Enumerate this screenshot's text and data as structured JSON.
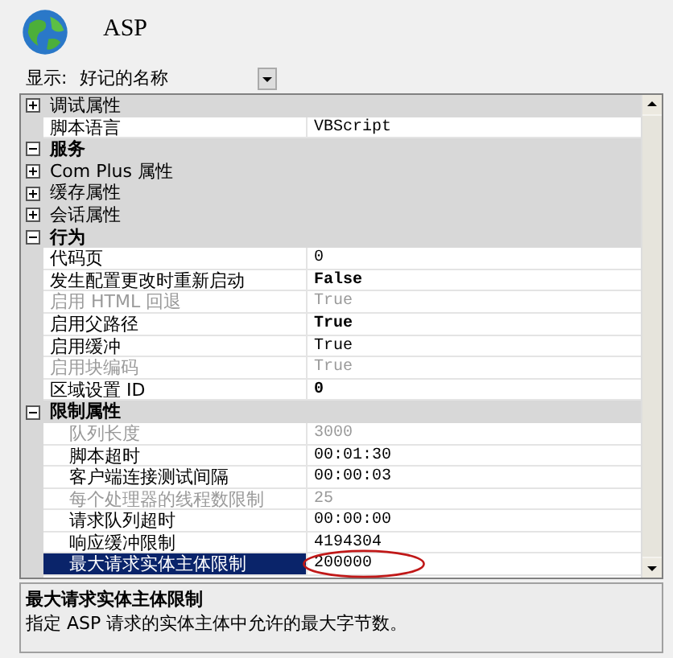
{
  "header": {
    "title": "ASP"
  },
  "display": {
    "label": "显示:",
    "value": "好记的名称"
  },
  "rows": [
    {
      "kind": "category",
      "name": "调试属性",
      "expanded": false
    },
    {
      "kind": "property",
      "name": "脚本语言",
      "value": "VBScript",
      "disabled": false,
      "modified": false,
      "selected": false,
      "circled": false
    },
    {
      "kind": "category",
      "name": "服务",
      "expanded": true,
      "children": [
        {
          "kind": "category",
          "name": "Com Plus 属性",
          "expanded": false
        },
        {
          "kind": "category",
          "name": "缓存属性",
          "expanded": false
        },
        {
          "kind": "category",
          "name": "会话属性",
          "expanded": false
        }
      ]
    },
    {
      "kind": "category",
      "name": "行为",
      "expanded": true,
      "children": [
        {
          "kind": "property",
          "name": "代码页",
          "value": "0",
          "disabled": false,
          "modified": false,
          "selected": false,
          "circled": false
        },
        {
          "kind": "property",
          "name": "发生配置更改时重新启动",
          "value": "False",
          "disabled": false,
          "modified": true,
          "selected": false,
          "circled": false
        },
        {
          "kind": "property",
          "name": "启用 HTML 回退",
          "value": "True",
          "disabled": true,
          "modified": false,
          "selected": false,
          "circled": false
        },
        {
          "kind": "property",
          "name": "启用父路径",
          "value": "True",
          "disabled": false,
          "modified": true,
          "selected": false,
          "circled": false
        },
        {
          "kind": "property",
          "name": "启用缓冲",
          "value": "True",
          "disabled": false,
          "modified": false,
          "selected": false,
          "circled": false
        },
        {
          "kind": "property",
          "name": "启用块编码",
          "value": "True",
          "disabled": true,
          "modified": false,
          "selected": false,
          "circled": false
        },
        {
          "kind": "property",
          "name": "区域设置 ID",
          "value": "0",
          "disabled": false,
          "modified": true,
          "selected": false,
          "circled": false
        },
        {
          "kind": "category",
          "name": "限制属性",
          "expanded": true,
          "children": [
            {
              "kind": "property",
              "name": "队列长度",
              "value": "3000",
              "disabled": true,
              "modified": false,
              "selected": false,
              "circled": false
            },
            {
              "kind": "property",
              "name": "脚本超时",
              "value": "00:01:30",
              "disabled": false,
              "modified": false,
              "selected": false,
              "circled": false
            },
            {
              "kind": "property",
              "name": "客户端连接测试间隔",
              "value": "00:00:03",
              "disabled": false,
              "modified": false,
              "selected": false,
              "circled": false
            },
            {
              "kind": "property",
              "name": "每个处理器的线程数限制",
              "value": "25",
              "disabled": true,
              "modified": false,
              "selected": false,
              "circled": false
            },
            {
              "kind": "property",
              "name": "请求队列超时",
              "value": "00:00:00",
              "disabled": false,
              "modified": false,
              "selected": false,
              "circled": false
            },
            {
              "kind": "property",
              "name": "响应缓冲限制",
              "value": "4194304",
              "disabled": false,
              "modified": false,
              "selected": false,
              "circled": false
            },
            {
              "kind": "property",
              "name": "最大请求实体主体限制",
              "value": "200000",
              "disabled": false,
              "modified": false,
              "selected": true,
              "circled": true
            }
          ]
        }
      ]
    }
  ],
  "description": {
    "title": "最大请求实体主体限制",
    "text": "指定 ASP 请求的实体主体中允许的最大字节数。"
  }
}
